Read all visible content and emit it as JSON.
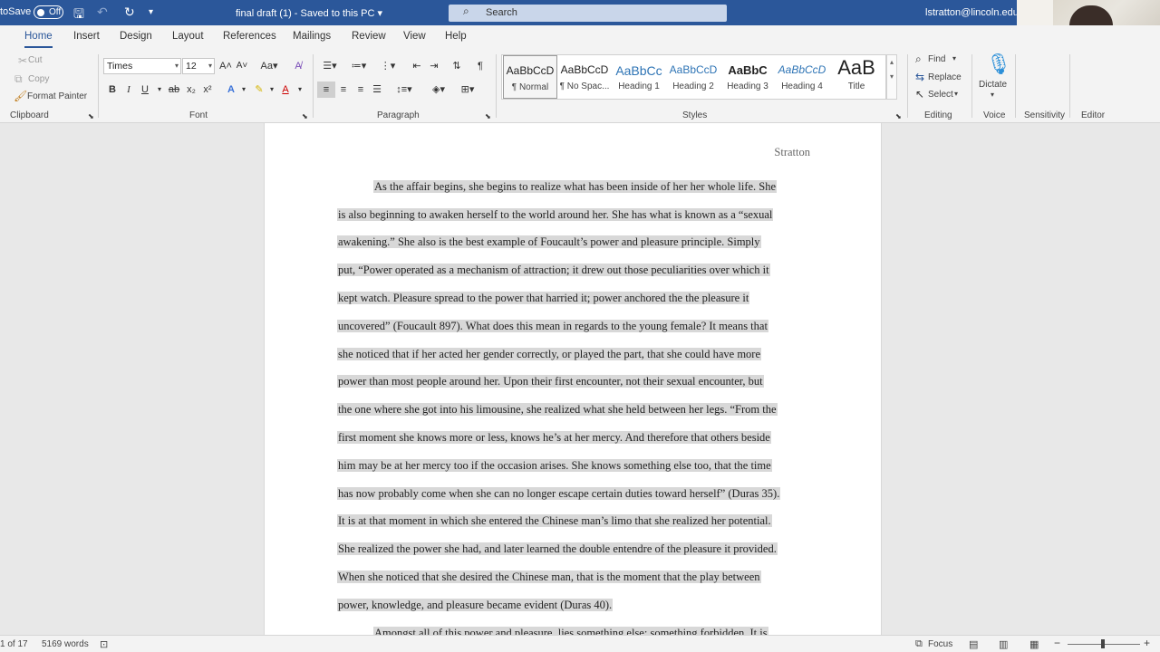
{
  "titlebar": {
    "autosave_label": "toSave",
    "autosave_state": "Off",
    "doc_title": "final draft (1)  -  Saved to this PC  ▾",
    "search_placeholder": "Search",
    "account": "lstratton@lincoln.edu",
    "qa_save_icon": "save-icon",
    "qa_undo_icon": "undo-icon",
    "qa_redo_icon": "redo-icon"
  },
  "tabs": [
    "Home",
    "Insert",
    "Design",
    "Layout",
    "References",
    "Mailings",
    "Review",
    "View",
    "Help"
  ],
  "ribbon": {
    "clipboard": {
      "cut": "Cut",
      "copy": "Copy",
      "format_painter": "Format Painter",
      "label": "Clipboard"
    },
    "font": {
      "name": "Times",
      "size": "12",
      "label": "Font"
    },
    "paragraph": {
      "label": "Paragraph"
    },
    "styles": {
      "label": "Styles",
      "items": [
        {
          "sample": "AaBbCcD",
          "name": "¶ Normal"
        },
        {
          "sample": "AaBbCcD",
          "name": "¶ No Spac..."
        },
        {
          "sample": "AaBbCc",
          "name": "Heading 1"
        },
        {
          "sample": "AaBbCcD",
          "name": "Heading 2"
        },
        {
          "sample": "AaBbC",
          "name": "Heading 3"
        },
        {
          "sample": "AaBbCcD",
          "name": "Heading 4"
        },
        {
          "sample": "AaB",
          "name": "Title"
        }
      ]
    },
    "editing": {
      "find": "Find",
      "replace": "Replace",
      "select": "Select",
      "label": "Editing"
    },
    "voice": {
      "dictate": "Dictate",
      "label": "Voice"
    },
    "sensitivity": {
      "label": "Sensitivity"
    },
    "editor": {
      "label": "Editor"
    }
  },
  "document": {
    "header": "Stratton",
    "lines": [
      "As the affair begins, she begins to realize what has been inside of her her whole life. She",
      "is also beginning to awaken herself to the world around her. She has what is known as a “sexual",
      "awakening.” She also is the best example of Foucault’s power and pleasure principle. Simply",
      "put, “Power operated as a mechanism of attraction; it drew out those peculiarities over which it",
      "kept watch. Pleasure spread to the power that harried it; power anchored the the pleasure it",
      "uncovered” (Foucault 897). What does this mean in regards to the young female? It means that",
      "she noticed that if her acted her gender correctly, or played the part, that she could have more",
      "power than most people around her. Upon their first encounter, not their sexual encounter, but",
      "the one where she got into his limousine, she realized what she held between her legs. “From the",
      "first moment she knows more or less, knows he’s at her mercy. And therefore that others beside",
      "him may be at her mercy too if the occasion arises. She knows something else too, that the time",
      "has now probably come when she can no longer escape certain duties toward herself” (Duras 35).",
      "It is at that moment in which she entered the Chinese man’s limo that she realized her potential.",
      "She realized the power she had, and later learned the double entendre of the pleasure it provided.",
      "When she noticed that she desired the Chinese man, that is the moment that the play between",
      "power, knowledge, and pleasure became evident (Duras 40).",
      "Amongst all of this power and pleasure, lies something else: something forbidden. It is"
    ]
  },
  "statusbar": {
    "page": "1 of 17",
    "words": "5169 words",
    "focus": "Focus"
  }
}
